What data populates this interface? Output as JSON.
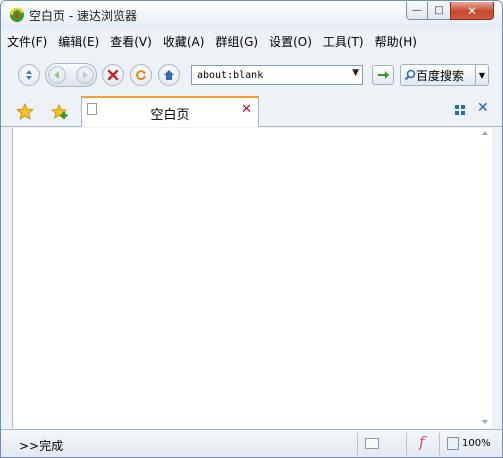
{
  "window": {
    "title": "空白页 - 速达浏览器",
    "controls": {
      "minimize": "—",
      "maximize": "□",
      "close": "✕"
    }
  },
  "menubar": {
    "items": [
      "文件(F)",
      "编辑(E)",
      "查看(V)",
      "收藏(A)",
      "群组(G)",
      "设置(O)",
      "工具(T)",
      "帮助(H)"
    ]
  },
  "toolbar": {
    "address_value": "about:blank",
    "search_label": "百度搜索",
    "icons": [
      "expand-icon",
      "back-icon",
      "forward-icon",
      "stop-icon",
      "refresh-icon",
      "home-icon",
      "go-arrow-icon",
      "search-icon"
    ]
  },
  "tabs": {
    "items": [
      {
        "label": "空白页",
        "active": true
      }
    ]
  },
  "statusbar": {
    "text": ">>完成",
    "zoom": "100%"
  },
  "colors": {
    "accent_tab": "#f3a02a",
    "close_red": "#c8102e",
    "link_blue": "#1f5fb0"
  }
}
